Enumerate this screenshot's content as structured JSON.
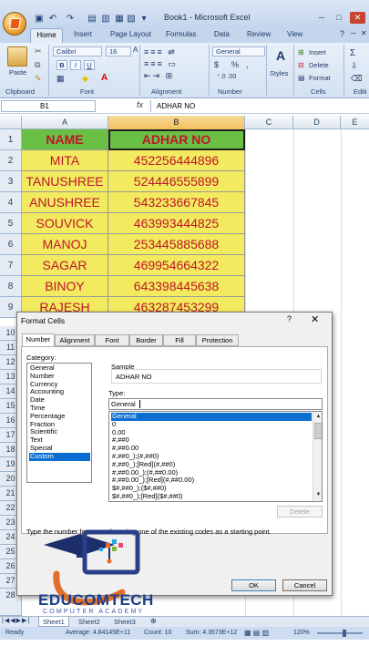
{
  "window": {
    "title": "Book1 - Microsoft Excel",
    "minimize": "─",
    "maximize": "□",
    "close": "✕"
  },
  "tabs": [
    "Home",
    "Insert",
    "Page Layout",
    "Formulas",
    "Data",
    "Review",
    "View"
  ],
  "ribbon": {
    "paste": "Paste",
    "font_name": "Calibri",
    "font_size": "16",
    "number_format": "General",
    "styles": "Styles",
    "insert": "Insert",
    "delete": "Delete",
    "format": "Format",
    "groups": [
      "Clipboard",
      "Font",
      "Alignment",
      "Number",
      "Cells",
      "Editi"
    ],
    "bold": "B",
    "italic": "I",
    "underline": "U",
    "currency": "$",
    "percent": "%"
  },
  "formula_bar": {
    "name_box": "B1",
    "fx": "fx",
    "formula": "ADHAR NO"
  },
  "grid": {
    "columns": [
      "A",
      "B",
      "C",
      "D",
      "E"
    ],
    "rows": [
      "1",
      "2",
      "3",
      "4",
      "5",
      "6",
      "7",
      "8",
      "9",
      "10",
      "11",
      "12",
      "13",
      "14",
      "15",
      "16",
      "17",
      "18",
      "19",
      "20",
      "21",
      "22",
      "23",
      "24",
      "25",
      "26",
      "27",
      "28"
    ],
    "header": {
      "name": "NAME",
      "adhar": "ADHAR NO"
    },
    "data": [
      {
        "name": "MITA",
        "adhar": "452256444896"
      },
      {
        "name": "TANUSHREE",
        "adhar": "524446555899"
      },
      {
        "name": "ANUSHREE",
        "adhar": "543233667845"
      },
      {
        "name": "SOUVICK",
        "adhar": "463993444825"
      },
      {
        "name": "MANOJ",
        "adhar": "253445885688"
      },
      {
        "name": "SAGAR",
        "adhar": "469954664322"
      },
      {
        "name": "BINOY",
        "adhar": "643398445638"
      },
      {
        "name": "RAJESH",
        "adhar": "463287453299"
      }
    ]
  },
  "dialog": {
    "title": "Format Cells",
    "help": "?",
    "close": "✕",
    "tabs": [
      "Number",
      "Alignment",
      "Font",
      "Border",
      "Fill",
      "Protection"
    ],
    "category_label": "Category:",
    "categories": [
      "General",
      "Number",
      "Currency",
      "Accounting",
      "Date",
      "Time",
      "Percentage",
      "Fraction",
      "Scientific",
      "Text",
      "Special",
      "Custom"
    ],
    "sample_label": "Sample",
    "sample_value": "ADHAR NO",
    "type_label": "Type:",
    "type_value": "General",
    "formats": [
      "General",
      "0",
      "0.00",
      "#,##0",
      "#,##0.00",
      "#,##0_);(#,##0)",
      "#,##0_);[Red](#,##0)",
      "#,##0.00_);(#,##0.00)",
      "#,##0.00_);[Red](#,##0.00)",
      "$#,##0_);($#,##0)",
      "$#,##0_);[Red]($#,##0)"
    ],
    "delete_label": "Delete",
    "hint": "Type the number format code, using one of the existing codes as a starting point.",
    "ok": "OK",
    "cancel": "Cancel"
  },
  "sheets": [
    "Sheet1",
    "Sheet2",
    "Sheet3"
  ],
  "status": {
    "ready": "Ready",
    "average": "Average: 4.84145E+11",
    "count": "Count: 10",
    "sum": "Sum: 4.3573E+12",
    "zoom": "120%"
  },
  "watermark": {
    "brand": "EDUCOMTECH",
    "tagline": "COMPUTER ACADEMY"
  },
  "colors": {
    "header_fill": "#6abf45",
    "data_fill": "#f2ea5f",
    "text_red": "#c0152a",
    "selection_blue": "#0a6ed1"
  }
}
